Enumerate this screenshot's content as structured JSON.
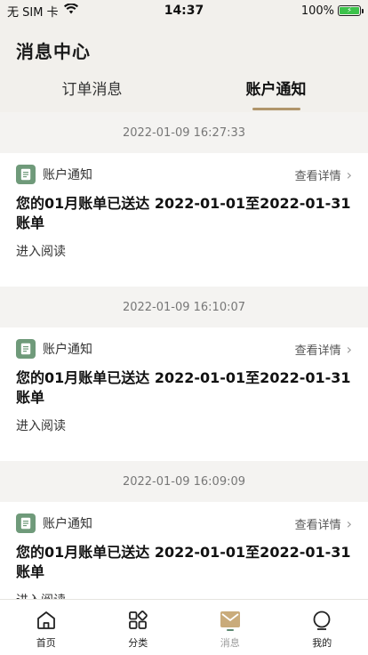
{
  "status": {
    "carrier": "无 SIM 卡",
    "time": "14:37",
    "battery": "100%"
  },
  "header": {
    "title": "消息中心",
    "tabs": [
      {
        "label": "订单消息",
        "active": false
      },
      {
        "label": "账户通知",
        "active": true
      }
    ]
  },
  "messages": [
    {
      "timestamp": "2022-01-09 16:27:33",
      "category": "账户通知",
      "detail_label": "查看详情",
      "title": "您的01月账单已送达 2022-01-01至2022-01-31账单",
      "read_label": "进入阅读"
    },
    {
      "timestamp": "2022-01-09 16:10:07",
      "category": "账户通知",
      "detail_label": "查看详情",
      "title": "您的01月账单已送达 2022-01-01至2022-01-31账单",
      "read_label": "进入阅读"
    },
    {
      "timestamp": "2022-01-09 16:09:09",
      "category": "账户通知",
      "detail_label": "查看详情",
      "title": "您的01月账单已送达 2022-01-01至2022-01-31账单",
      "read_label": "进入阅读"
    }
  ],
  "tabbar": [
    {
      "label": "首页",
      "icon": "home-icon"
    },
    {
      "label": "分类",
      "icon": "category-icon"
    },
    {
      "label": "消息",
      "icon": "message-icon",
      "active": true
    },
    {
      "label": "我的",
      "icon": "profile-icon"
    }
  ],
  "colors": {
    "accent": "#b0956a",
    "doc_icon": "#6f9a7a",
    "header_bg": "#f2f0ec"
  }
}
